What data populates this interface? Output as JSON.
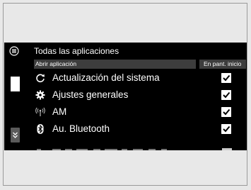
{
  "header": {
    "title": "Todas las aplicaciones"
  },
  "columns": {
    "app": "Abrir aplicación",
    "home": "En pant. inicio"
  },
  "rows": [
    {
      "label": "Actualización del sistema",
      "icon": "refresh-icon",
      "checked": true
    },
    {
      "label": "Ajustes generales",
      "icon": "gear-icon",
      "checked": true
    },
    {
      "label": "AM",
      "icon": "radio-antenna-icon",
      "checked": true
    },
    {
      "label": "Au. Bluetooth",
      "icon": "bluetooth-icon",
      "checked": true
    }
  ],
  "colors": {
    "background": "#000000",
    "column_header": "#3d3d3d",
    "text": "#ffffff"
  }
}
